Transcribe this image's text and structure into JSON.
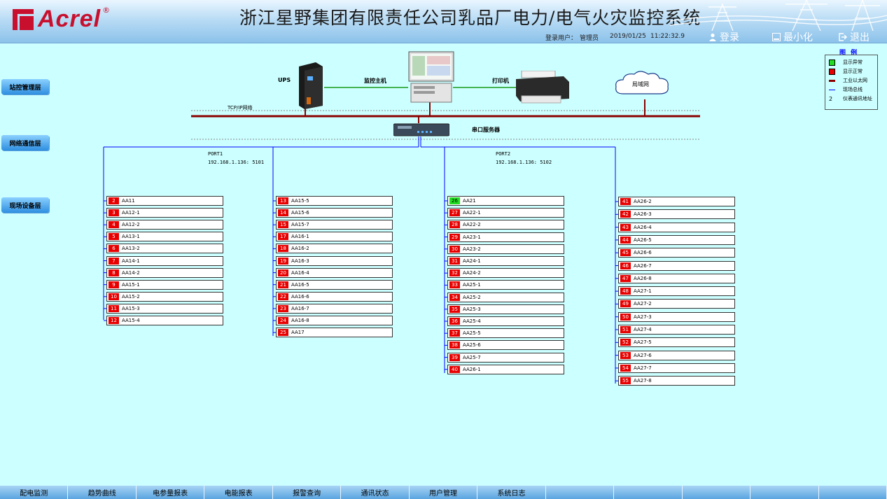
{
  "header": {
    "logo_text": "Acrel",
    "logo_reg": "®",
    "title": "浙江星野集团有限责任公司乳品厂电力/电气火灾监控系统",
    "user_label": "登录用户：",
    "user_name": "管理员",
    "date": "2019/01/25",
    "time": "11:22:32.9",
    "login": "登录",
    "minimize": "最小化",
    "exit": "退出"
  },
  "legend": {
    "title": "图 例",
    "items": [
      {
        "label": "显示异常",
        "color": "#22dd22"
      },
      {
        "label": "显示正常",
        "color": "#e80000"
      },
      {
        "label": "工业以太网",
        "color": "#8b0000"
      },
      {
        "label": "现场总线",
        "color": "#0000ff"
      },
      {
        "symbol": "2",
        "label": "仪表通讯地址"
      }
    ]
  },
  "layers": {
    "station": "站控管理层",
    "network": "网络通信层",
    "field": "现场设备层"
  },
  "devices": {
    "ups": "UPS",
    "host": "监控主机",
    "printer": "打印机",
    "lan": "局域网",
    "tcpip": "TCP/IP网络",
    "serial": "串口服务器",
    "port1_name": "PORT1",
    "port1_addr": "192.168.1.136: 5101",
    "port2_name": "PORT2",
    "port2_addr": "192.168.1.136: 5102"
  },
  "columns": [
    {
      "meters": [
        {
          "n": "2",
          "name": "AA11"
        },
        {
          "n": "3",
          "name": "AA12-1"
        },
        {
          "n": "4",
          "name": "AA12-2"
        },
        {
          "n": "5",
          "name": "AA13-1"
        },
        {
          "n": "6",
          "name": "AA13-2"
        },
        {
          "n": "7",
          "name": "AA14-1"
        },
        {
          "n": "8",
          "name": "AA14-2"
        },
        {
          "n": "9",
          "name": "AA15-1"
        },
        {
          "n": "10",
          "name": "AA15-2"
        },
        {
          "n": "11",
          "name": "AA15-3"
        },
        {
          "n": "12",
          "name": "AA15-4"
        }
      ]
    },
    {
      "meters": [
        {
          "n": "13",
          "name": "AA15-5"
        },
        {
          "n": "14",
          "name": "AA15-6"
        },
        {
          "n": "15",
          "name": "AA15-7"
        },
        {
          "n": "17",
          "name": "AA16-1"
        },
        {
          "n": "18",
          "name": "AA16-2"
        },
        {
          "n": "19",
          "name": "AA16-3"
        },
        {
          "n": "20",
          "name": "AA16-4"
        },
        {
          "n": "21",
          "name": "AA16-5"
        },
        {
          "n": "22",
          "name": "AA16-6"
        },
        {
          "n": "23",
          "name": "AA16-7"
        },
        {
          "n": "24",
          "name": "AA16-8"
        },
        {
          "n": "25",
          "name": "AA17"
        }
      ]
    },
    {
      "meters": [
        {
          "n": "26",
          "name": "AA21",
          "ok": true
        },
        {
          "n": "27",
          "name": "AA22-1"
        },
        {
          "n": "28",
          "name": "AA22-2"
        },
        {
          "n": "29",
          "name": "AA23-1"
        },
        {
          "n": "30",
          "name": "AA23-2"
        },
        {
          "n": "31",
          "name": "AA24-1"
        },
        {
          "n": "32",
          "name": "AA24-2"
        },
        {
          "n": "33",
          "name": "AA25-1"
        },
        {
          "n": "34",
          "name": "AA25-2"
        },
        {
          "n": "35",
          "name": "AA25-3"
        },
        {
          "n": "36",
          "name": "AA25-4"
        },
        {
          "n": "37",
          "name": "AA25-5"
        },
        {
          "n": "38",
          "name": "AA25-6"
        },
        {
          "n": "39",
          "name": "AA25-7"
        },
        {
          "n": "40",
          "name": "AA26-1"
        }
      ]
    },
    {
      "meters": [
        {
          "n": "41",
          "name": "AA26-2"
        },
        {
          "n": "42",
          "name": "AA26-3"
        },
        {
          "n": "43",
          "name": "AA26-4"
        },
        {
          "n": "44",
          "name": "AA26-5"
        },
        {
          "n": "45",
          "name": "AA26-6"
        },
        {
          "n": "46",
          "name": "AA26-7"
        },
        {
          "n": "47",
          "name": "AA26-8"
        },
        {
          "n": "48",
          "name": "AA27-1"
        },
        {
          "n": "49",
          "name": "AA27-2"
        },
        {
          "n": "50",
          "name": "AA27-3"
        },
        {
          "n": "51",
          "name": "AA27-4"
        },
        {
          "n": "52",
          "name": "AA27-5"
        },
        {
          "n": "53",
          "name": "AA27-6"
        },
        {
          "n": "54",
          "name": "AA27-7"
        },
        {
          "n": "55",
          "name": "AA27-8"
        }
      ]
    }
  ],
  "nav": [
    "配电监测",
    "趋势曲线",
    "电参量报表",
    "电能报表",
    "报警查询",
    "通讯状态",
    "用户管理",
    "系统日志",
    "",
    "",
    "",
    "",
    ""
  ]
}
